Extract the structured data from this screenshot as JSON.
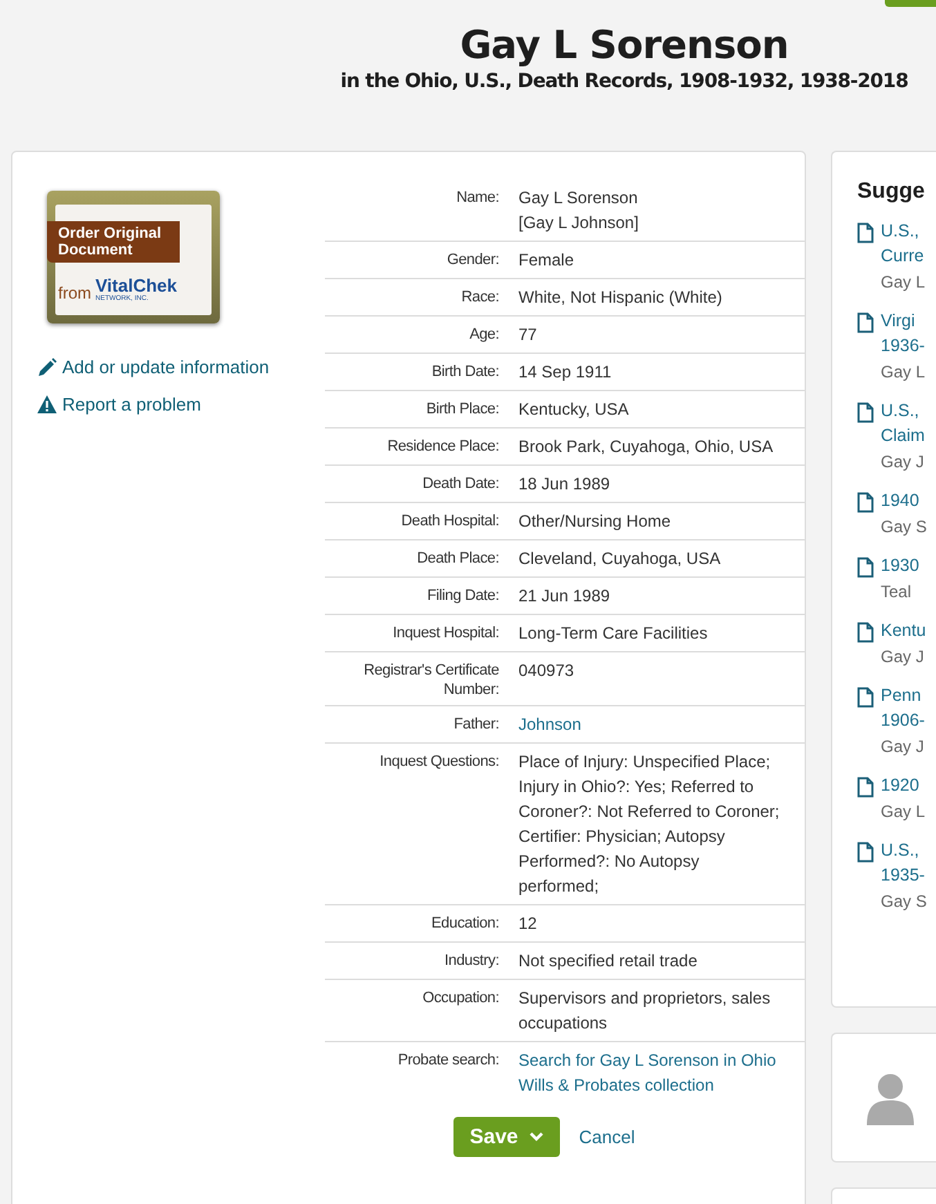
{
  "header": {
    "title": "Gay L Sorenson",
    "subtitle": "in the Ohio, U.S., Death Records, 1908-1932, 1938-2018"
  },
  "order_document": {
    "banner": "Order Original Document",
    "from": "from",
    "brand": "VitalChek",
    "brand_sub": "NETWORK, INC."
  },
  "actions": [
    {
      "kind": "edit",
      "label": "Add or update information"
    },
    {
      "kind": "report",
      "label": "Report a problem"
    }
  ],
  "record": [
    {
      "label": "Name:",
      "values": [
        "Gay L Sorenson",
        "[Gay L Johnson]"
      ],
      "link": false
    },
    {
      "label": "Gender:",
      "values": [
        "Female"
      ],
      "link": false
    },
    {
      "label": "Race:",
      "values": [
        "White, Not Hispanic (White)"
      ],
      "link": false
    },
    {
      "label": "Age:",
      "values": [
        "77"
      ],
      "link": false
    },
    {
      "label": "Birth Date:",
      "values": [
        "14 Sep 1911"
      ],
      "link": false
    },
    {
      "label": "Birth Place:",
      "values": [
        "Kentucky, USA"
      ],
      "link": false
    },
    {
      "label": "Residence Place:",
      "values": [
        "Brook Park, Cuyahoga, Ohio, USA"
      ],
      "link": false
    },
    {
      "label": "Death Date:",
      "values": [
        "18 Jun 1989"
      ],
      "link": false
    },
    {
      "label": "Death Hospital:",
      "values": [
        "Other/Nursing Home"
      ],
      "link": false
    },
    {
      "label": "Death Place:",
      "values": [
        "Cleveland, Cuyahoga, USA"
      ],
      "link": false
    },
    {
      "label": "Filing Date:",
      "values": [
        "21 Jun 1989"
      ],
      "link": false
    },
    {
      "label": "Inquest Hospital:",
      "values": [
        "Long-Term Care Facilities"
      ],
      "link": false
    },
    {
      "label": "Registrar's Certificate Number:",
      "values": [
        "040973"
      ],
      "link": false
    },
    {
      "label": "Father:",
      "values": [
        "Johnson"
      ],
      "link": true
    },
    {
      "label": "Inquest Questions:",
      "values": [
        "Place of Injury: Unspecified Place; Injury in Ohio?: Yes; Referred to Coroner?: Not Referred to Coroner; Certifier: Physician; Autopsy Performed?: No Autopsy performed;"
      ],
      "link": false
    },
    {
      "label": "Education:",
      "values": [
        "12"
      ],
      "link": false
    },
    {
      "label": "Industry:",
      "values": [
        "Not specified retail trade"
      ],
      "link": false
    },
    {
      "label": "Occupation:",
      "values": [
        "Supervisors and proprietors, sales occupations"
      ],
      "link": false
    },
    {
      "label": "Probate search:",
      "values": [
        "Search for Gay L Sorenson in Ohio Wills & Probates collection"
      ],
      "link": true
    }
  ],
  "buttons": {
    "save": "Save",
    "cancel": "Cancel"
  },
  "suggested": {
    "title": "Sugge",
    "items": [
      {
        "title": [
          "U.S.,",
          "Curre"
        ],
        "name": "Gay L"
      },
      {
        "title": [
          "Virgi",
          "1936-"
        ],
        "name": "Gay L"
      },
      {
        "title": [
          "U.S.,",
          "Claim"
        ],
        "name": "Gay J"
      },
      {
        "title": [
          "1940"
        ],
        "name": "Gay S"
      },
      {
        "title": [
          "1930"
        ],
        "name": "Teal"
      },
      {
        "title": [
          "Kentu"
        ],
        "name": "Gay J"
      },
      {
        "title": [
          "Penn",
          "1906-"
        ],
        "name": "Gay J"
      },
      {
        "title": [
          "1920"
        ],
        "name": "Gay L"
      },
      {
        "title": [
          "U.S.,",
          "1935-"
        ],
        "name": "Gay S"
      }
    ]
  }
}
